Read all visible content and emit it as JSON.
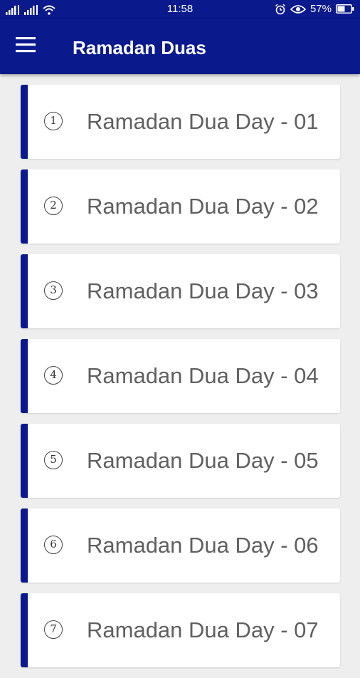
{
  "status_bar": {
    "time": "11:58",
    "battery": "57%",
    "icons": [
      "signal-icon",
      "signal-icon",
      "wifi-icon",
      "alarm-icon",
      "eye-icon",
      "battery-icon"
    ]
  },
  "app_bar": {
    "title": "Ramadan Duas",
    "menu_icon": "hamburger-menu-icon"
  },
  "colors": {
    "primary": "#0A1A8C",
    "background": "#EEEEEE",
    "card": "#FFFFFF",
    "text": "#606060"
  },
  "items": [
    {
      "number": "1",
      "label": "Ramadan Dua Day - 01"
    },
    {
      "number": "2",
      "label": "Ramadan Dua Day - 02"
    },
    {
      "number": "3",
      "label": "Ramadan Dua Day - 03"
    },
    {
      "number": "4",
      "label": "Ramadan Dua Day - 04"
    },
    {
      "number": "5",
      "label": "Ramadan Dua Day - 05"
    },
    {
      "number": "6",
      "label": "Ramadan Dua Day - 06"
    },
    {
      "number": "7",
      "label": "Ramadan Dua Day - 07"
    }
  ]
}
